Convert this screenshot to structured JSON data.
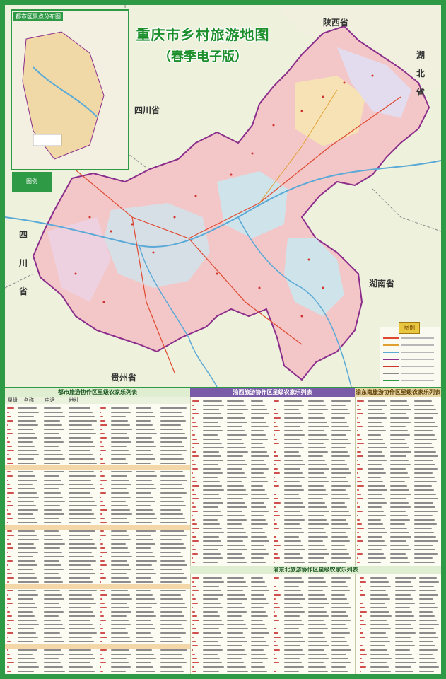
{
  "map": {
    "title_line1": "重庆市乡村旅游地图",
    "title_line2": "（春季电子版）",
    "provinces": [
      {
        "key": "shaanxi",
        "label": "陕西省"
      },
      {
        "key": "hubei",
        "label": "湖北省"
      },
      {
        "key": "sichuan_top",
        "label": "四川省"
      },
      {
        "key": "sichuan_left",
        "label": "四川省"
      },
      {
        "key": "hunan",
        "label": "湖南省"
      },
      {
        "key": "guizhou",
        "label": "贵州省"
      }
    ],
    "inset_title": "都市区景点分布图",
    "inset_badge": "图例",
    "legend_title": "图例"
  },
  "tables": {
    "left_title": "都市旅游协作区星级农家乐列表",
    "middle_title": "渝西旅游协作区星级农家乐列表",
    "right_title": "渝东南旅游协作区星级农家乐列表",
    "bottom_title": "渝东北旅游协作区星级农家乐列表",
    "columns": [
      "星级",
      "名称",
      "电话",
      "地址"
    ]
  },
  "colors": {
    "frame_green": "#2f9a45",
    "title_green": "#1d8f2c",
    "header_purple": "#7a5ba8",
    "header_tan": "#e8d7a6",
    "map_pink": "#f3c6c8",
    "map_blue": "#cfe3ea"
  }
}
